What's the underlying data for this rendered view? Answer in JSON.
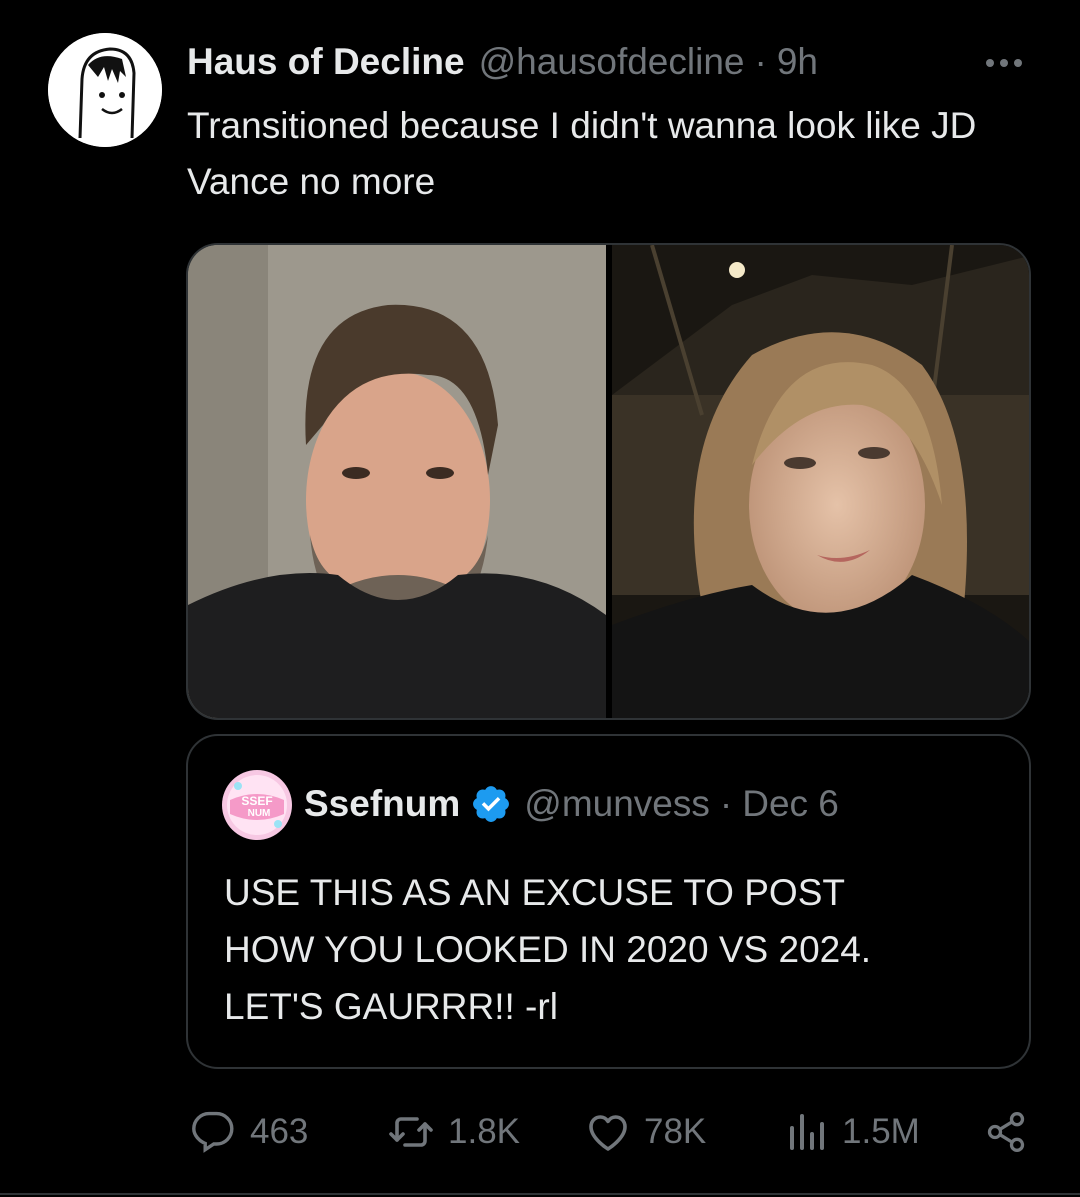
{
  "tweet": {
    "display_name": "Haus of Decline",
    "handle": "@hausofdecline",
    "separator": "·",
    "time": "9h",
    "text": "Transitioned because I didn't wanna look like JD Vance no more",
    "avatar_icon": "cartoon-face-avatar",
    "more_icon": "more-dots-icon"
  },
  "quoted": {
    "display_name": "Ssefnum",
    "handle": "@munvess",
    "separator": "·",
    "date": "Dec 6",
    "text_lines": [
      "USE THIS AS AN EXCUSE TO POST",
      "HOW YOU LOOKED IN 2020 VS 2024.",
      "LET'S GAURRR!! -rl"
    ],
    "avatar_label": "SSEF NUM",
    "verified_color": "#1d9bf0"
  },
  "actions": {
    "replies": "463",
    "retweets": "1.8K",
    "likes": "78K",
    "views": "1.5M"
  },
  "colors": {
    "background": "#000000",
    "text": "#e7e9ea",
    "muted": "#71767b",
    "border": "#2f3336",
    "accent": "#1d9bf0"
  }
}
